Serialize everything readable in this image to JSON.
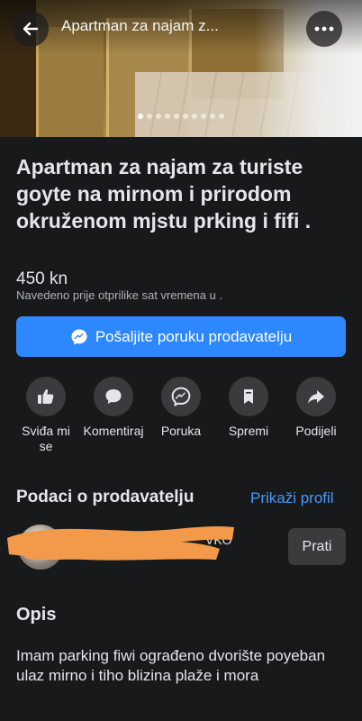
{
  "header": {
    "title": "Apartman za najam z..."
  },
  "gallery": {
    "dot_count": 10,
    "active_index": 0
  },
  "listing": {
    "title": "Apartman za najam za turiste goyte na mirnom i prirodom okruženom mjstu prking i fifi .",
    "price": "450 kn",
    "listed": "Navedeno prije otprilike sat vremena u ."
  },
  "message_button": {
    "label": "Pošaljite poruku prodavatelju",
    "icon": "messenger-icon"
  },
  "actions": [
    {
      "label": "Sviđa mi se",
      "icon": "thumbs-up-icon"
    },
    {
      "label": "Komentiraj",
      "icon": "comment-icon"
    },
    {
      "label": "Poruka",
      "icon": "messenger-icon"
    },
    {
      "label": "Spremi",
      "icon": "bookmark-icon"
    },
    {
      "label": "Podijeli",
      "icon": "share-icon"
    }
  ],
  "seller": {
    "heading": "Podaci o prodavatelju",
    "profile_link": "Prikaži profil",
    "name_visible": "VKO",
    "follow_label": "Prati"
  },
  "description": {
    "heading": "Opis",
    "text": "Imam parking fiwi ograđeno dvorište poyeban ulaz mirno i tiho blizina plaže i mora"
  },
  "colors": {
    "background": "#18191a",
    "accent": "#2d88ff",
    "link": "#4599ff",
    "button_gray": "#3a3b3c",
    "redaction": "#f39a4a"
  }
}
